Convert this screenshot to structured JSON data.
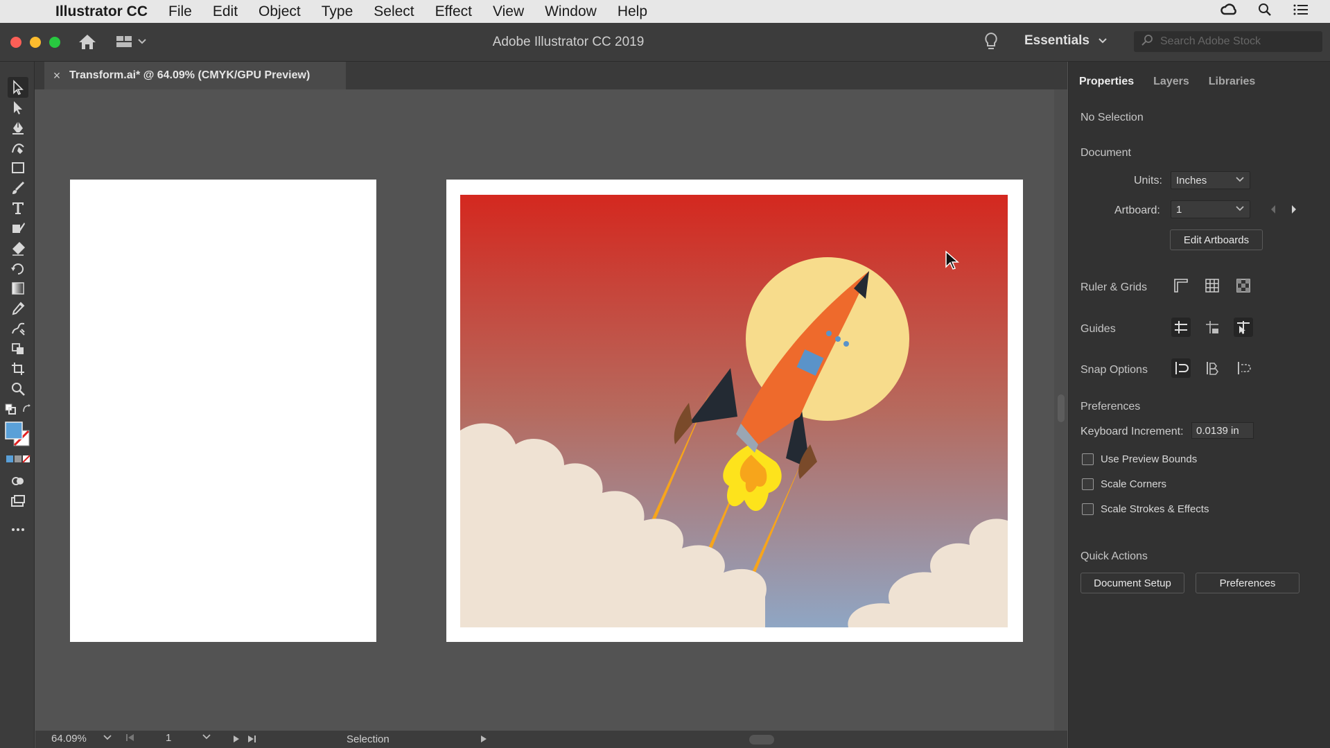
{
  "menubar": {
    "app_name": "Illustrator CC",
    "items": [
      "File",
      "Edit",
      "Object",
      "Type",
      "Select",
      "Effect",
      "View",
      "Window",
      "Help"
    ]
  },
  "appbar": {
    "title": "Adobe Illustrator CC 2019",
    "workspace": "Essentials",
    "search_placeholder": "Search Adobe Stock"
  },
  "document_tab": {
    "label": "Transform.ai* @ 64.09% (CMYK/GPU Preview)",
    "close": "×"
  },
  "statusbar": {
    "zoom": "64.09%",
    "artboard_number": "1",
    "mode": "Selection"
  },
  "panel": {
    "tabs": [
      "Properties",
      "Layers",
      "Libraries"
    ],
    "selection_state": "No Selection",
    "document_heading": "Document",
    "units_label": "Units:",
    "units_value": "Inches",
    "artboard_label": "Artboard:",
    "artboard_value": "1",
    "edit_artboards": "Edit Artboards",
    "ruler_grids": "Ruler & Grids",
    "guides": "Guides",
    "snap_options": "Snap Options",
    "preferences_heading": "Preferences",
    "keyboard_increment_label": "Keyboard Increment:",
    "keyboard_increment_value": "0.0139 in",
    "checkboxes": [
      {
        "label": "Use Preview Bounds",
        "checked": false
      },
      {
        "label": "Scale Corners",
        "checked": false
      },
      {
        "label": "Scale Strokes & Effects",
        "checked": false
      }
    ],
    "quick_actions_heading": "Quick Actions",
    "document_setup": "Document Setup",
    "preferences_button": "Preferences"
  },
  "colors": {
    "fill_swatch": "#5aa0d8",
    "sky_top": "#d4281f",
    "sky_bottom": "#8fa6c4",
    "moon": "#f7dc8c",
    "rocket_body": "#ee6a2c",
    "rocket_dark": "#232a33",
    "cloud": "#efe2d3"
  }
}
